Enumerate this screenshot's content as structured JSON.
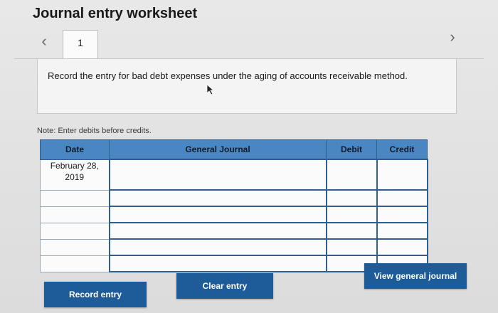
{
  "header": {
    "title": "Journal entry worksheet",
    "tab_number": "1",
    "prev_icon": "chevron-left-icon",
    "next_icon": "chevron-right-icon"
  },
  "instruction": {
    "text": "Record the entry for bad debt expenses under the aging of accounts receivable method."
  },
  "note": "Note: Enter debits before credits.",
  "table": {
    "headers": {
      "date": "Date",
      "general_journal": "General Journal",
      "debit": "Debit",
      "credit": "Credit"
    },
    "rows": [
      {
        "date": "February 28, 2019",
        "account": "",
        "debit": "",
        "credit": ""
      },
      {
        "date": "",
        "account": "",
        "debit": "",
        "credit": ""
      },
      {
        "date": "",
        "account": "",
        "debit": "",
        "credit": ""
      },
      {
        "date": "",
        "account": "",
        "debit": "",
        "credit": ""
      },
      {
        "date": "",
        "account": "",
        "debit": "",
        "credit": ""
      },
      {
        "date": "",
        "account": "",
        "debit": "",
        "credit": ""
      }
    ]
  },
  "buttons": {
    "record": "Record entry",
    "clear": "Clear entry",
    "view": "View general journal"
  },
  "colors": {
    "header_blue": "#4a86c2",
    "button_blue": "#1d5c99",
    "grid_border": "#2f5f8f"
  }
}
